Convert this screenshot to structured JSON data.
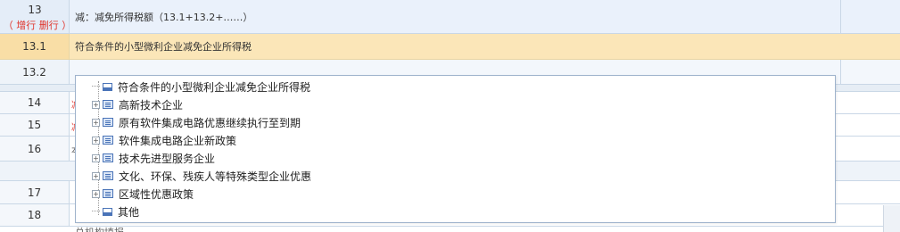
{
  "rows": {
    "r13": {
      "num": "13",
      "label": "减：减免所得税额（13.1+13.2+……）"
    },
    "r13_links": {
      "prefix": "（",
      "add": "增行",
      "delete": "删行",
      "suffix": "）"
    },
    "r13_1": {
      "num": "13.1",
      "label": "符合条件的小型微利企业减免企业所得税"
    },
    "r13_2": {
      "num": "13.2",
      "label": ""
    },
    "r14": {
      "num": "14",
      "mark": "减"
    },
    "r15": {
      "num": "15",
      "mark": "减"
    },
    "r16": {
      "num": "16",
      "mark": "本"
    },
    "r17": {
      "num": "17"
    },
    "r18": {
      "num": "18"
    },
    "peek_text": "总机构填报"
  },
  "dropdown": {
    "items": [
      {
        "label": "符合条件的小型微利企业减免企业所得税",
        "expandable": false
      },
      {
        "label": "高新技术企业",
        "expandable": true
      },
      {
        "label": "原有软件集成电路优惠继续执行至到期",
        "expandable": true
      },
      {
        "label": "软件集成电路企业新政策",
        "expandable": true
      },
      {
        "label": "技术先进型服务企业",
        "expandable": true
      },
      {
        "label": "文化、环保、残疾人等特殊类型企业优惠",
        "expandable": true
      },
      {
        "label": "区域性优惠政策",
        "expandable": true
      },
      {
        "label": "其他",
        "expandable": false
      }
    ],
    "expander_symbol": "+"
  },
  "colors": {
    "highlight_row": "#fbe6b8",
    "link_red": "#e0332a",
    "icon_blue": "#4a74b8",
    "grid_line": "#c9d7e6"
  }
}
